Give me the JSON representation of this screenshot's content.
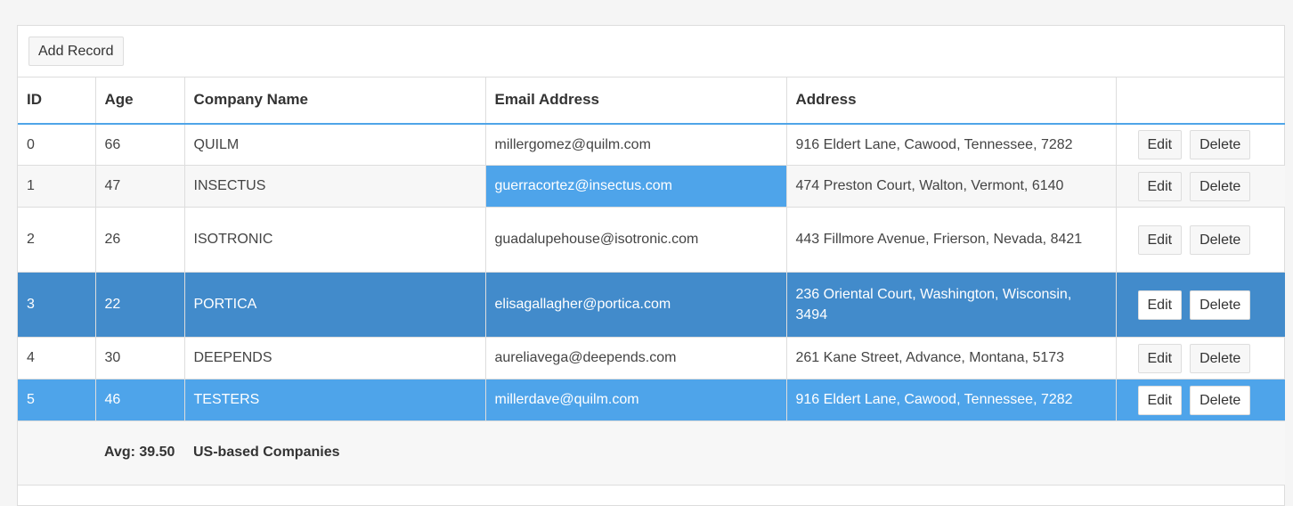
{
  "toolbar": {
    "add_label": "Add Record"
  },
  "columns": [
    "ID",
    "Age",
    "Company Name",
    "Email Address",
    "Address",
    ""
  ],
  "rows": [
    {
      "id": "0",
      "age": "66",
      "company": "QUILM",
      "email": "millergomez@quilm.com",
      "address": "916 Eldert Lane, Cawood, Tennessee, 7282"
    },
    {
      "id": "1",
      "age": "47",
      "company": "INSECTUS",
      "email": "guerracortez@insectus.com",
      "address": "474 Preston Court, Walton, Vermont, 6140"
    },
    {
      "id": "2",
      "age": "26",
      "company": "ISOTRONIC",
      "email": "guadalupehouse@isotronic.com",
      "address": "443 Fillmore Avenue, Frierson, Nevada, 8421"
    },
    {
      "id": "3",
      "age": "22",
      "company": "PORTICA",
      "email": "elisagallagher@portica.com",
      "address": "236 Oriental Court, Washington, Wisconsin, 3494"
    },
    {
      "id": "4",
      "age": "30",
      "company": "DEEPENDS",
      "email": "aureliavega@deepends.com",
      "address": "261 Kane Street, Advance, Montana, 5173"
    },
    {
      "id": "5",
      "age": "46",
      "company": "TESTERS",
      "email": "millerdave@quilm.com",
      "address": "916 Eldert Lane, Cawood, Tennessee, 7282"
    }
  ],
  "actions": {
    "edit_label": "Edit",
    "delete_label": "Delete"
  },
  "footer": {
    "age_summary": "Avg: 39.50",
    "company_summary": "US-based Companies"
  },
  "colors": {
    "header_accent": "#4fa5e8",
    "selected_dark": "#428bcb",
    "selected_light": "#4ea4ea"
  }
}
